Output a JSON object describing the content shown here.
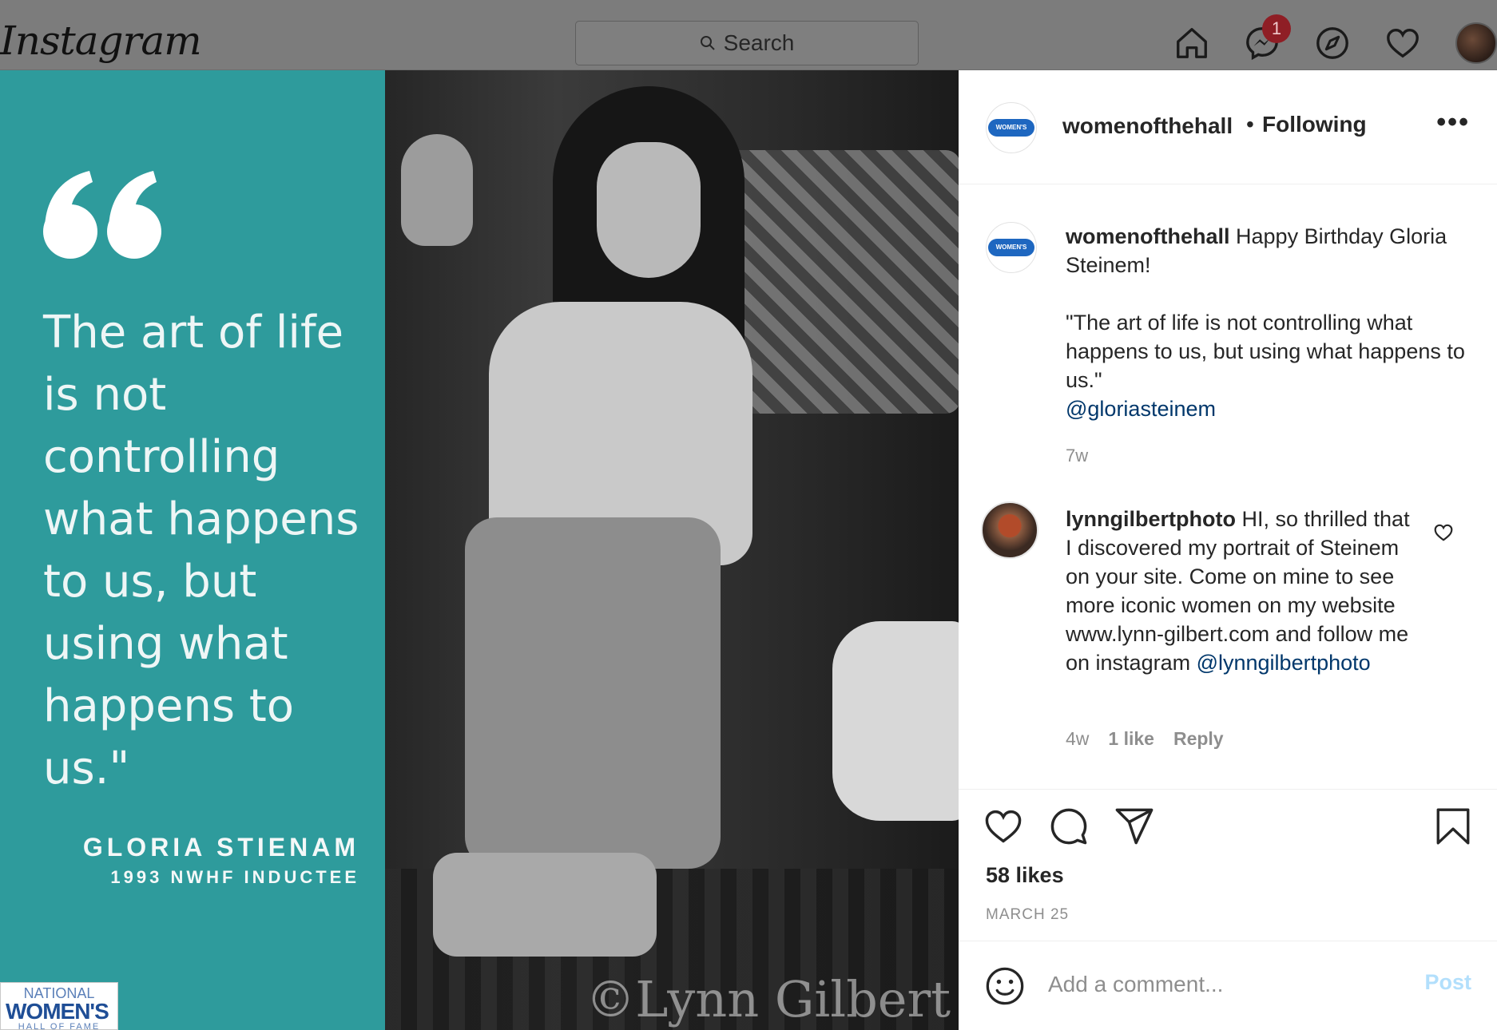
{
  "app": {
    "logo": "Instagram"
  },
  "search": {
    "placeholder": "Search"
  },
  "nav": {
    "messages_badge": "1"
  },
  "post_image": {
    "quote": "The art of life is not controlling what happens to us, but using what happens to us.\"",
    "author": "GLORIA STIENAM",
    "subtitle": "1993 NWHF INDUCTEE",
    "logo_line1": "NATIONAL",
    "logo_line2": "WOMEN'S",
    "logo_line3": "HALL OF FAME",
    "photo_credit": "©Lynn Gilbert",
    "panel_color": "#2e9b9c"
  },
  "header": {
    "username": "womenofthehall",
    "separator": "•",
    "follow_status": "Following",
    "more": "•••"
  },
  "caption": {
    "username": "womenofthehall",
    "line1": " Happy Birthday Gloria Steinem!",
    "quote": "\"The art of life is not controlling what happens to us, but using what happens to us.\"",
    "mention": "@gloriasteinem",
    "age": "7w"
  },
  "comment": {
    "username": "lynngilbertphoto",
    "text": " HI, so thrilled that I discovered my portrait of Steinem on your site. Come on mine to see more iconic women on my website www.lynn-gilbert.com and follow me on instagram ",
    "mention": "@lynngilbertphoto",
    "age": "4w",
    "likes": "1 like",
    "reply": "Reply"
  },
  "engagement": {
    "likes": "58 likes",
    "date": "MARCH 25"
  },
  "add_comment": {
    "placeholder": "Add a comment...",
    "post_label": "Post"
  }
}
